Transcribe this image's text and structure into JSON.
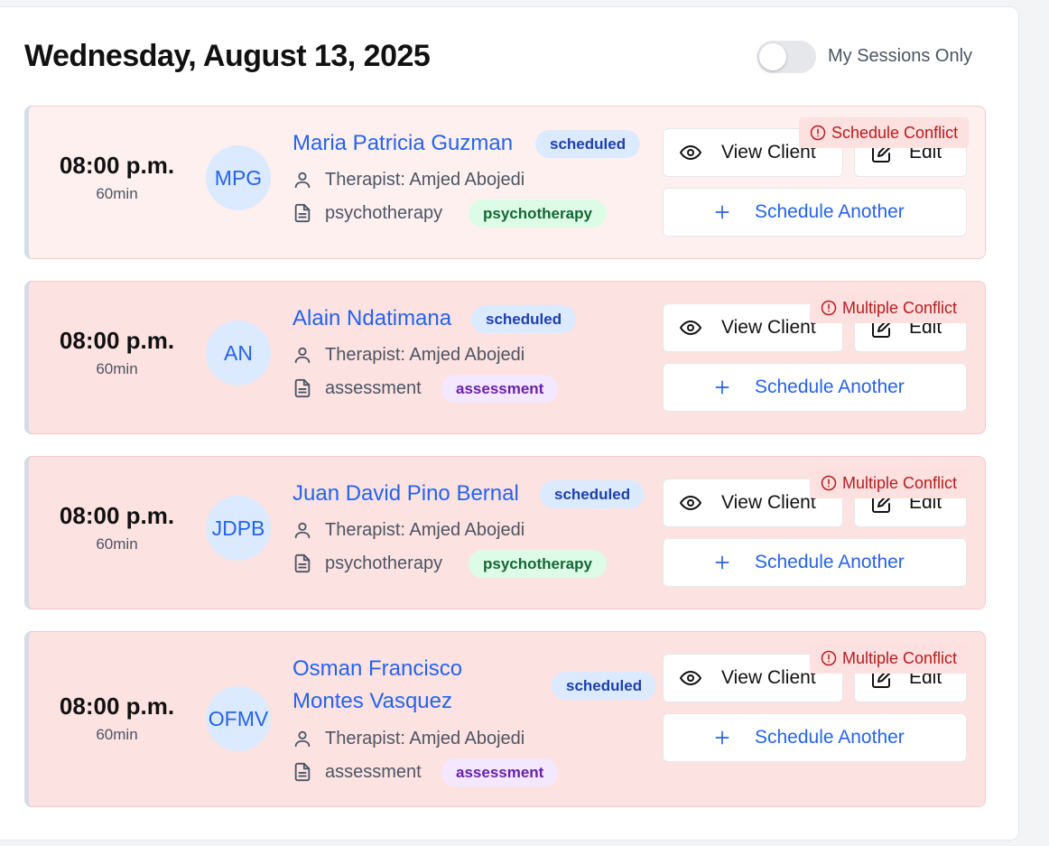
{
  "header": {
    "date_title": "Wednesday, August 13, 2025",
    "toggle_label": "My Sessions Only",
    "toggle_on": false
  },
  "labels": {
    "view_client": "View Client",
    "edit": "Edit",
    "schedule_another": "Schedule Another"
  },
  "colors": {
    "accent": "#2563eb",
    "conflict_text": "#b91c1c",
    "card_bg_light": "#fff0f0",
    "card_bg": "#fde2e2"
  },
  "sessions": [
    {
      "time": "08:00 p.m.",
      "duration": "60min",
      "initials": "MPG",
      "name": "Maria Patricia Guzman",
      "status": "scheduled",
      "therapist": "Therapist: Amjed Abojedi",
      "type": "psychotherapy",
      "type_badge": "psychotherapy",
      "conflict": "Schedule Conflict"
    },
    {
      "time": "08:00 p.m.",
      "duration": "60min",
      "initials": "AN",
      "name": "Alain Ndatimana",
      "status": "scheduled",
      "therapist": "Therapist: Amjed Abojedi",
      "type": "assessment",
      "type_badge": "assessment",
      "conflict": "Multiple Conflict"
    },
    {
      "time": "08:00 p.m.",
      "duration": "60min",
      "initials": "JDPB",
      "name": "Juan David Pino Bernal",
      "status": "scheduled",
      "therapist": "Therapist: Amjed Abojedi",
      "type": "psychotherapy",
      "type_badge": "psychotherapy",
      "conflict": "Multiple Conflict"
    },
    {
      "time": "08:00 p.m.",
      "duration": "60min",
      "initials": "OFMV",
      "name_line1": "Osman Francisco",
      "name_line2": "Montes Vasquez",
      "status": "scheduled",
      "therapist": "Therapist: Amjed Abojedi",
      "type": "assessment",
      "type_badge": "assessment",
      "conflict": "Multiple Conflict"
    }
  ]
}
